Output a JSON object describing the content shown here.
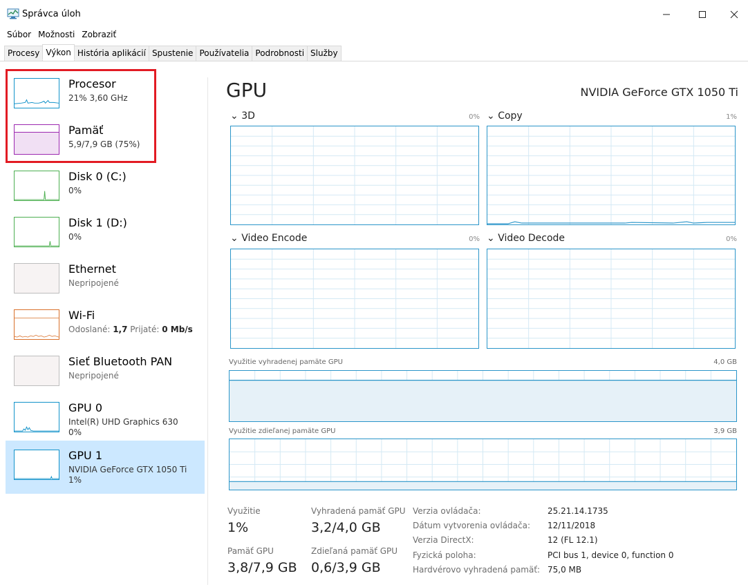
{
  "window": {
    "title": "Správca úloh"
  },
  "menu": [
    "Súbor",
    "Možnosti",
    "Zobraziť"
  ],
  "tabs": [
    "Procesy",
    "Výkon",
    "História aplikácií",
    "Spustenie",
    "Používatelia",
    "Podrobnosti",
    "Služby"
  ],
  "active_tab": "Výkon",
  "sidebar": [
    {
      "name": "Procesor",
      "sub": "21% 3,60 GHz",
      "color": "#1192c9"
    },
    {
      "name": "Pamäť",
      "sub": "5,9/7,9 GB (75%)",
      "color": "#9c27b0"
    },
    {
      "name": "Disk 0 (C:)",
      "sub": "0%",
      "color": "#4caf50"
    },
    {
      "name": "Disk 1 (D:)",
      "sub": "0%",
      "color": "#4caf50"
    },
    {
      "name": "Ethernet",
      "sub": "Nepripojené",
      "color": "#a6a6a6"
    },
    {
      "name": "Wi-Fi",
      "sub_parts": [
        "Odoslané: ",
        "1,7",
        " Prijaté: ",
        "0 Mb/s"
      ],
      "color": "#d9702a"
    },
    {
      "name": "Sieť Bluetooth PAN",
      "sub": "Nepripojené",
      "color": "#a6a6a6"
    },
    {
      "name": "GPU 0",
      "sub": "Intel(R) UHD Graphics 630",
      "sub2": "0%",
      "color": "#1192c9"
    },
    {
      "name": "GPU 1",
      "sub": "NVIDIA GeForce GTX 1050 Ti",
      "sub2": "1%",
      "color": "#1192c9"
    }
  ],
  "main": {
    "title": "GPU",
    "device": "NVIDIA GeForce GTX 1050 Ti",
    "engines": [
      {
        "label": "3D",
        "percent": "0%"
      },
      {
        "label": "Copy",
        "percent": "1%"
      },
      {
        "label": "Video Encode",
        "percent": "0%"
      },
      {
        "label": "Video Decode",
        "percent": "0%"
      }
    ],
    "dedicated_memory": {
      "label": "Využitie vyhradenej pamäte GPU",
      "max": "4,0 GB"
    },
    "shared_memory": {
      "label": "Využitie zdieľanej pamäte GPU",
      "max": "3,9 GB"
    }
  },
  "stats": {
    "utilization": {
      "label": "Využitie",
      "value": "1%"
    },
    "dedicated": {
      "label": "Vyhradená pamäť GPU",
      "value": "3,2/4,0 GB"
    },
    "gpu_memory": {
      "label": "Pamäť GPU",
      "value": "3,8/7,9 GB"
    },
    "shared": {
      "label": "Zdieľaná pamäť GPU",
      "value": "0,6/3,9 GB"
    }
  },
  "info": [
    {
      "label": "Verzia ovládača:",
      "value": "25.21.14.1735"
    },
    {
      "label": "Dátum vytvorenia ovládača:",
      "value": "12/11/2018"
    },
    {
      "label": "Verzia DirectX:",
      "value": "12 (FL 12.1)"
    },
    {
      "label": "Fyzická poloha:",
      "value": "PCI bus 1, device 0, function 0"
    },
    {
      "label": "Hardvérovo vyhradená pamäť:",
      "value": "75,0 MB"
    }
  ],
  "colors": {
    "accent": "#2a95c9",
    "selected": "#cce8ff",
    "highlight_box": "#e21b23"
  }
}
